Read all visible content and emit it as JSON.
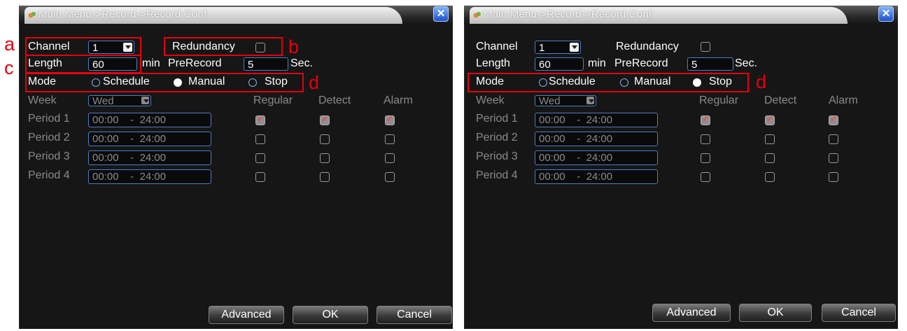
{
  "dialogs": [
    {
      "title": "Main Menu->Record->Record Conf.",
      "close_icon": "close-icon",
      "channel": {
        "label": "Channel",
        "value": "1"
      },
      "redundancy": {
        "label": "Redundancy",
        "checked": false
      },
      "length": {
        "label": "Length",
        "value": "60",
        "unit": "min"
      },
      "prerecord": {
        "label": "PreRecord",
        "value": "5",
        "unit": "Sec."
      },
      "mode": {
        "label": "Mode",
        "options": [
          "Schedule",
          "Manual",
          "Stop"
        ],
        "selected": "Manual"
      },
      "week": {
        "label": "Week",
        "value": "Wed"
      },
      "columns": [
        "Regular",
        "Detect",
        "Alarm"
      ],
      "periods": [
        {
          "label": "Period 1",
          "start": "00:00",
          "sep": "-",
          "end": "24:00",
          "regular": true,
          "detect": true,
          "alarm": true
        },
        {
          "label": "Period 2",
          "start": "00:00",
          "sep": "-",
          "end": "24:00",
          "regular": false,
          "detect": false,
          "alarm": false
        },
        {
          "label": "Period 3",
          "start": "00:00",
          "sep": "-",
          "end": "24:00",
          "regular": false,
          "detect": false,
          "alarm": false
        },
        {
          "label": "Period 4",
          "start": "00:00",
          "sep": "-",
          "end": "24:00",
          "regular": false,
          "detect": false,
          "alarm": false
        }
      ],
      "buttons": {
        "advanced": "Advanced",
        "ok": "OK",
        "cancel": "Cancel"
      }
    },
    {
      "title": "Main Menu->Record->Record Conf.",
      "close_icon": "close-icon",
      "channel": {
        "label": "Channel",
        "value": "1"
      },
      "redundancy": {
        "label": "Redundancy",
        "checked": false
      },
      "length": {
        "label": "Length",
        "value": "60",
        "unit": "min"
      },
      "prerecord": {
        "label": "PreRecord",
        "value": "5",
        "unit": "Sec."
      },
      "mode": {
        "label": "Mode",
        "options": [
          "Schedule",
          "Manual",
          "Stop"
        ],
        "selected": "Stop"
      },
      "week": {
        "label": "Week",
        "value": "Wed"
      },
      "columns": [
        "Regular",
        "Detect",
        "Alarm"
      ],
      "periods": [
        {
          "label": "Period 1",
          "start": "00:00",
          "sep": "-",
          "end": "24:00",
          "regular": true,
          "detect": true,
          "alarm": true
        },
        {
          "label": "Period 2",
          "start": "00:00",
          "sep": "-",
          "end": "24:00",
          "regular": false,
          "detect": false,
          "alarm": false
        },
        {
          "label": "Period 3",
          "start": "00:00",
          "sep": "-",
          "end": "24:00",
          "regular": false,
          "detect": false,
          "alarm": false
        },
        {
          "label": "Period 4",
          "start": "00:00",
          "sep": "-",
          "end": "24:00",
          "regular": false,
          "detect": false,
          "alarm": false
        }
      ],
      "buttons": {
        "advanced": "Advanced",
        "ok": "OK",
        "cancel": "Cancel"
      }
    }
  ],
  "annotations": {
    "a": "a",
    "b": "b",
    "c": "c",
    "d": "d"
  },
  "colors": {
    "highlight": "#e4000f",
    "field_border": "#4b7fc4",
    "background": "#161616"
  }
}
